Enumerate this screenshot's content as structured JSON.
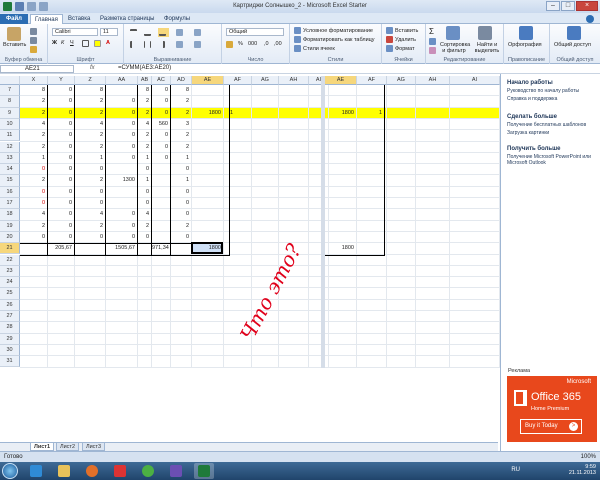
{
  "window": {
    "title": "Картриджи Солнышко_2 - Microsoft Excel Starter"
  },
  "ribbon_tabs": [
    "Файл",
    "Главная",
    "Вставка",
    "Разметка страницы",
    "Формулы"
  ],
  "ribbon": {
    "paste": "Вставить",
    "clipboard": "Буфер обмена",
    "font_name": "Calibri",
    "font_size": "11",
    "font_group": "Шрифт",
    "align_group": "Выравнивание",
    "number_format": "Общий",
    "number_group": "Число",
    "cond_format": "Условное форматирование",
    "format_table": "Форматировать как таблицу",
    "cell_styles": "Стили ячеек",
    "styles_group": "Стили",
    "insert": "Вставить",
    "delete": "Удалить",
    "format": "Формат",
    "cells_group": "Ячейки",
    "sort_filter": "Сортировка и фильтр",
    "find_select": "Найти и выделить",
    "editing_group": "Редактирование",
    "spelling": "Орфография",
    "proofing_group": "Правописание",
    "sharing": "Общий доступ",
    "sharing_group": "Общий доступ"
  },
  "formula_bar": {
    "name_box": "AE21",
    "fx": "fx",
    "formula": "=СУММ(AE3:AE20)"
  },
  "columns_left": [
    "X",
    "Y",
    "Z",
    "AA",
    "AB",
    "AC",
    "AD",
    "AE",
    "AF",
    "AG",
    "AH",
    "AI"
  ],
  "columns_right": [
    "AE",
    "AF",
    "AG",
    "AH",
    "AI"
  ],
  "rows": [
    "7",
    "8",
    "9",
    "10",
    "11",
    "12",
    "13",
    "14",
    "15",
    "16",
    "17",
    "18",
    "19",
    "20",
    "21",
    "22",
    "23",
    "24",
    "25",
    "26",
    "27",
    "28",
    "29",
    "30",
    "31"
  ],
  "cells": {
    "r7": [
      "8",
      "0",
      "8",
      "",
      "8",
      "0",
      "8"
    ],
    "r8": [
      "2",
      "0",
      "2",
      "0",
      "2",
      "0",
      "2"
    ],
    "r9": [
      "2",
      "0",
      "2",
      "0",
      "2",
      "0",
      "2"
    ],
    "r10": [
      "4",
      "0",
      "4",
      "0",
      "4",
      "560",
      "3"
    ],
    "r11": [
      "2",
      "0",
      "2",
      "0",
      "2",
      "0",
      "2"
    ],
    "r12": [
      "2",
      "0",
      "2",
      "0",
      "2",
      "0",
      "2"
    ],
    "r13": [
      "1",
      "0",
      "1",
      "0",
      "1",
      "0",
      "1"
    ],
    "r14": [
      "0",
      "0",
      "0",
      "",
      "0",
      "",
      "0"
    ],
    "r15": [
      "2",
      "0",
      "2",
      "1300",
      "1",
      "",
      "1"
    ],
    "r16": [
      "0",
      "0",
      "0",
      "",
      "0",
      "",
      "0"
    ],
    "r17": [
      "0",
      "0",
      "0",
      "",
      "0",
      "",
      "0"
    ],
    "r18": [
      "4",
      "0",
      "4",
      "0",
      "4",
      "",
      "0"
    ],
    "r19": [
      "2",
      "0",
      "2",
      "0",
      "2",
      "",
      "2"
    ],
    "r20": [
      "0",
      "0",
      "0",
      "0",
      "0",
      "",
      "0"
    ],
    "r21": [
      "",
      "205,67",
      "",
      "1505,67",
      "",
      "971,34",
      ""
    ]
  },
  "highlight": {
    "ae9_left": "1800",
    "af9_left": "1",
    "ae21_left": "1800",
    "ae9_right": "1800",
    "af9_right": "1",
    "ae21_right": "1800"
  },
  "annotation": "Что это?",
  "sheet_tabs": [
    "Лист1",
    "Лист2",
    "Лист3"
  ],
  "status": {
    "ready": "Готово",
    "zoom": "100%"
  },
  "side_pane": {
    "s1_title": "Начало работы",
    "s1_l1": "Руководство по началу работы",
    "s1_l2": "Справка и поддержка",
    "s2_title": "Сделать больше",
    "s2_l1": "Получение бесплатных шаблонов",
    "s2_l2": "Загрузка картинки",
    "s3_title": "Получить больше",
    "s3_l1": "Получение Microsoft PowerPoint или Microsoft Outlook",
    "ad_label": "Реклама",
    "ad_brand": "Microsoft",
    "ad_product": "Office 365",
    "ad_edition": "Home Premium",
    "ad_cta": "Buy it Today"
  },
  "taskbar": {
    "lang": "RU",
    "time": "9:59",
    "date": "21.11.2013"
  },
  "colors": {
    "highlight": "#ffff00",
    "red_value": "#d40000",
    "ad_bg": "#e8481c",
    "file_tab": "#2c6db3"
  }
}
